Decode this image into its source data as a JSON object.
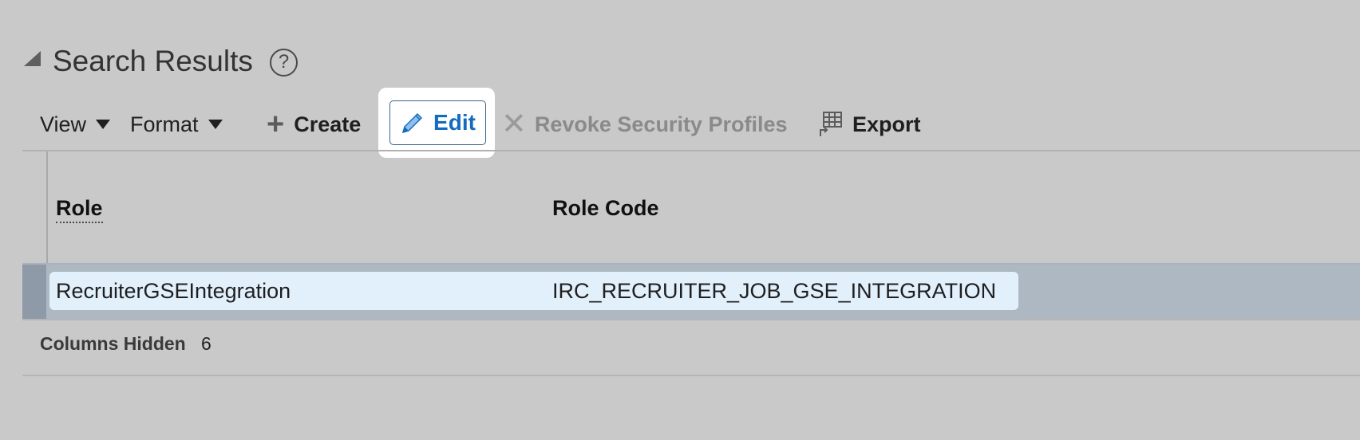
{
  "section": {
    "title": "Search Results",
    "help_glyph": "?"
  },
  "toolbar": {
    "view_label": "View",
    "format_label": "Format",
    "create_label": "Create",
    "edit_label": "Edit",
    "revoke_label": "Revoke Security Profiles",
    "export_label": "Export",
    "icons": {
      "collapse": "triangle-collapse-icon",
      "help": "help-circle-icon",
      "create": "plus-icon",
      "edit": "pencil-icon",
      "revoke": "x-icon",
      "export": "export-grid-icon"
    }
  },
  "table": {
    "columns": [
      "Role",
      "Role Code"
    ],
    "rows": [
      {
        "role": "RecruiterGSEIntegration",
        "role_code": "IRC_RECRUITER_JOB_GSE_INTEGRATION",
        "selected": true
      }
    ]
  },
  "footer": {
    "columns_hidden_label": "Columns Hidden",
    "columns_hidden_count": "6"
  },
  "colors": {
    "background": "#c9c9c9",
    "edit_accent": "#146cc0",
    "selected_row": "#aeb8c3",
    "row_highlight": "#e2f0fc",
    "disabled_text": "#8a8a8a"
  }
}
